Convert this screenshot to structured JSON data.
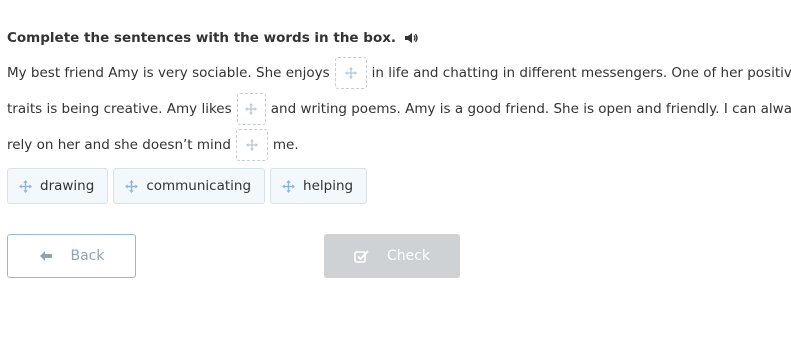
{
  "task": {
    "instruction": "Complete the sentences with the words in the box.",
    "audio_icon": "speaker-icon"
  },
  "text": {
    "line1_a": "My best friend Amy is very sociable. She enjoys",
    "line1_b": "in life and chatting in different messengers. One of her positive",
    "line2_a": "traits is being creative. Amy likes",
    "line2_b": "and writing poems. Amy is a good friend. She is open and friendly. I can always",
    "line3_a": "rely on her and she doesn’t mind",
    "line3_b": "me."
  },
  "gaps": [
    {
      "value": "",
      "icon": "move-icon"
    },
    {
      "value": "",
      "icon": "move-icon"
    },
    {
      "value": "",
      "icon": "move-icon"
    }
  ],
  "word_bank": {
    "items": [
      {
        "label": "drawing",
        "icon": "move-icon"
      },
      {
        "label": "communicating",
        "icon": "move-icon"
      },
      {
        "label": "helping",
        "icon": "move-icon"
      }
    ]
  },
  "buttons": {
    "back_label": "Back",
    "back_icon": "arrow-left-icon",
    "check_label": "Check",
    "check_icon": "checkbox-icon",
    "check_enabled": false
  },
  "colors": {
    "text": "#333333",
    "gap_border": "#c8ccd2",
    "chip_background": "#f3f8fc",
    "chip_border": "#d6e1ec",
    "icon_blue": "#8fb4d8",
    "back_border": "#9ab9d3",
    "back_text": "#8fa4b8",
    "check_disabled_bg": "#cfd2d5"
  }
}
